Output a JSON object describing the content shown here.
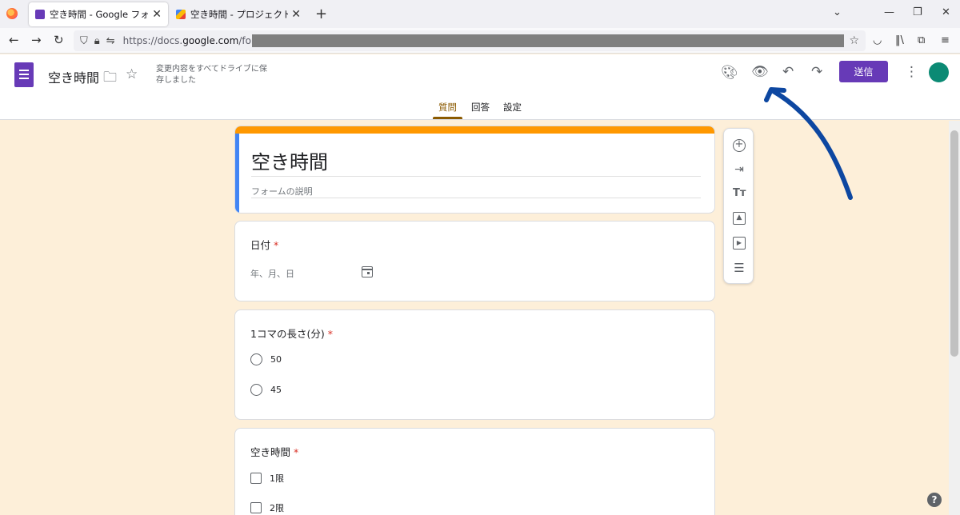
{
  "browser": {
    "tabs": [
      {
        "label": "空き時間 - Google フォーム",
        "close": "✕"
      },
      {
        "label": "空き時間 - プロジェクト編集者 - Ap",
        "close": "✕"
      }
    ],
    "new_tab": "+",
    "window_controls": {
      "minimize": "—",
      "restore": "❐",
      "close": "✕"
    },
    "url": {
      "prefix": "https://docs.",
      "domain": "google.com",
      "path": "/forms/"
    }
  },
  "forms_header": {
    "doc_title": "空き時間",
    "save_status": "変更内容をすべてドライブに保存しました",
    "send_label": "送信",
    "tabs": [
      "質問",
      "回答",
      "設定"
    ],
    "active_tab": "質問"
  },
  "form": {
    "title": "空き時間",
    "description_placeholder": "フォームの説明",
    "questions": [
      {
        "title": "日付",
        "required": "*",
        "placeholder": "年、月、日"
      },
      {
        "title": "1コマの長さ(分)",
        "required": "*",
        "options": [
          "50",
          "45"
        ]
      },
      {
        "title": "空き時間",
        "required": "*",
        "options": [
          "1限",
          "2限"
        ]
      }
    ]
  },
  "annotation_color": "#0d47a1",
  "accent_colors": {
    "form_theme": "#ff9800",
    "forms_purple": "#673ab7",
    "page_bg": "#fdefd9"
  }
}
